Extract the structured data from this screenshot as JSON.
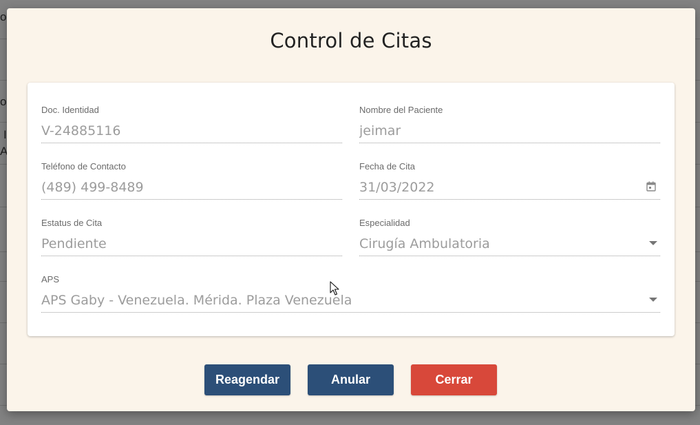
{
  "background": {
    "texts": [
      "o",
      "o",
      "I",
      "A"
    ]
  },
  "modal": {
    "title": "Control de Citas"
  },
  "form": {
    "doc_identidad": {
      "label": "Doc. Identidad",
      "value": "V-24885116"
    },
    "nombre_paciente": {
      "label": "Nombre del Paciente",
      "value": "jeimar"
    },
    "telefono": {
      "label": "Teléfono de Contacto",
      "value": "(489) 499-8489"
    },
    "fecha_cita": {
      "label": "Fecha de Cita",
      "value": "31/03/2022",
      "icon": "calendar-icon"
    },
    "estatus": {
      "label": "Estatus de Cita",
      "value": "Pendiente"
    },
    "especialidad": {
      "label": "Especialidad",
      "value": "Cirugía Ambulatoria",
      "icon": "chevron-down-icon"
    },
    "aps": {
      "label": "APS",
      "value": "APS Gaby - Venezuela. Mérida. Plaza Venezuela",
      "icon": "chevron-down-icon"
    }
  },
  "buttons": {
    "reagendar": "Reagendar",
    "anular": "Anular",
    "cerrar": "Cerrar"
  },
  "colors": {
    "primary": "#2c4f78",
    "danger": "#d8483a",
    "modal_bg": "#fbf4ea"
  }
}
